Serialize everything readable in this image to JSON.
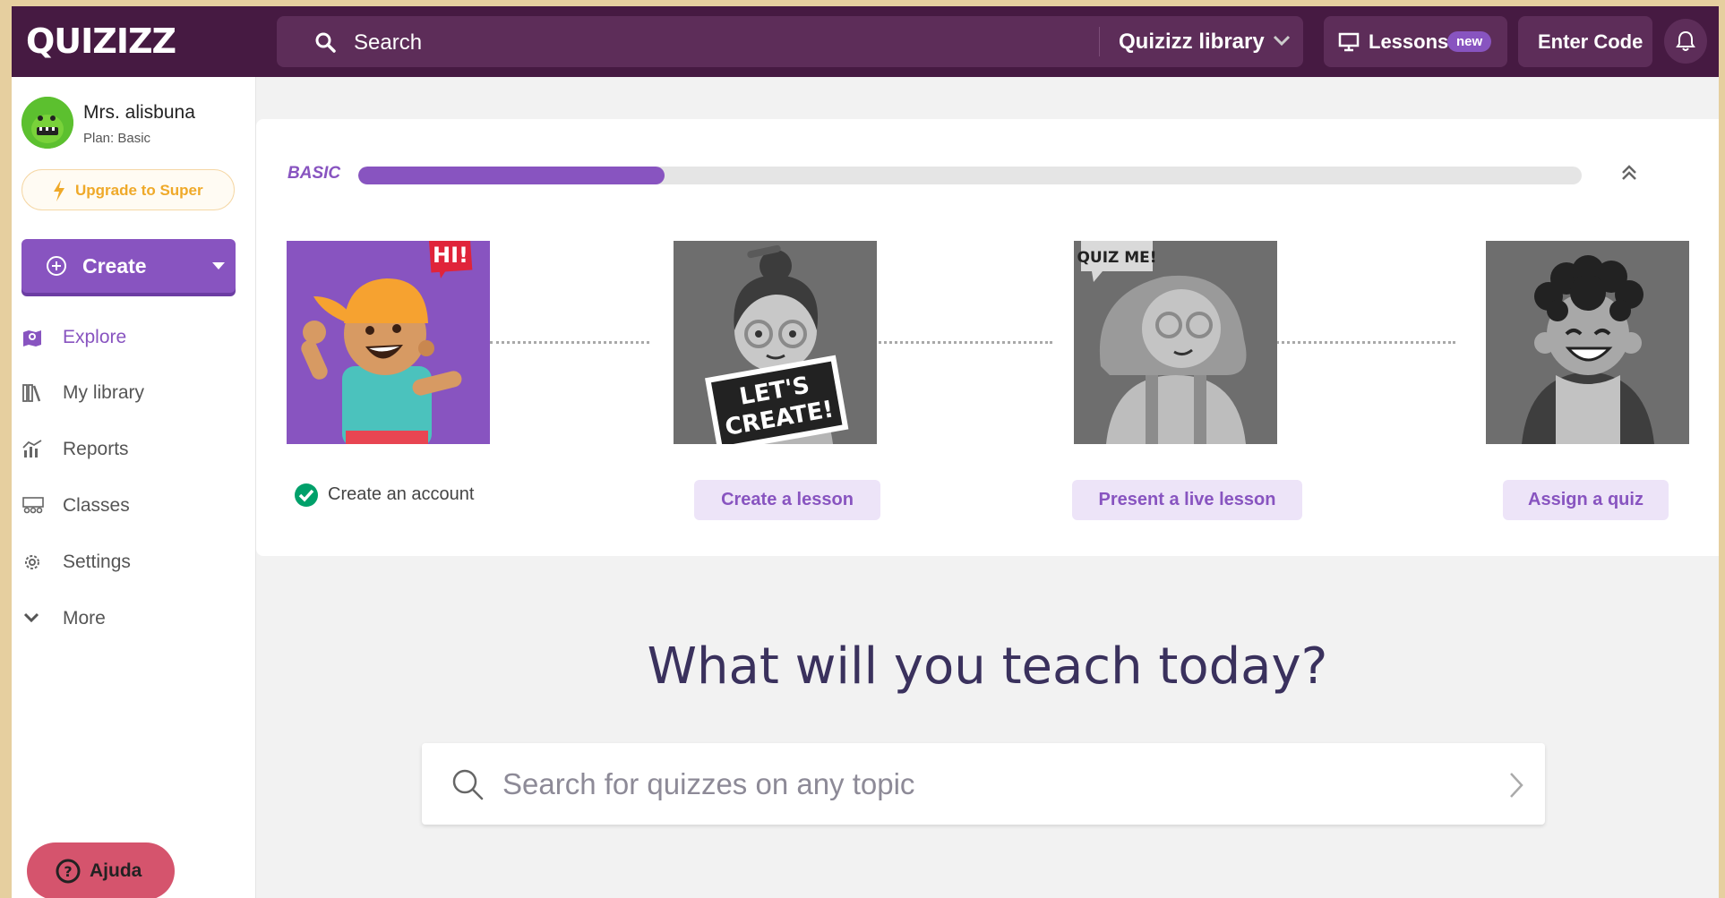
{
  "nav": {
    "logo": "QUIZIZZ",
    "search_placeholder": "Search",
    "library_select": "Quizizz library",
    "lessons_label": "Lessons",
    "lessons_badge": "new",
    "enter_code": "Enter Code"
  },
  "user": {
    "name": "Mrs. alisbuna",
    "plan": "Plan: Basic",
    "upgrade_label": "Upgrade to Super"
  },
  "sidebar": {
    "create_label": "Create",
    "items": [
      {
        "label": "Explore",
        "icon": "explore-icon",
        "active": true
      },
      {
        "label": "My library",
        "icon": "library-icon",
        "active": false
      },
      {
        "label": "Reports",
        "icon": "reports-icon",
        "active": false
      },
      {
        "label": "Classes",
        "icon": "classes-icon",
        "active": false
      },
      {
        "label": "Settings",
        "icon": "settings-icon",
        "active": false
      },
      {
        "label": "More",
        "icon": "chevron-down-icon",
        "active": false
      }
    ],
    "help_label": "Ajuda"
  },
  "onboarding": {
    "plan_label": "BASIC",
    "progress_fraction": 0.25,
    "steps": [
      {
        "label": "Create an account",
        "completed": true
      },
      {
        "label": "Create a lesson",
        "completed": false
      },
      {
        "label": "Present a live lesson",
        "completed": false
      },
      {
        "label": "Assign a quiz",
        "completed": false
      }
    ],
    "step_badges": {
      "hi": "HI!",
      "lets_create_1": "LET'S",
      "lets_create_2": "CREATE!",
      "quiz_me": "QUIZ ME!"
    }
  },
  "main": {
    "title": "What will you teach today?",
    "search_placeholder": "Search for quizzes on any topic"
  },
  "colors": {
    "nav_bg": "#461a42",
    "accent": "#8854c0",
    "upgrade": "#efa929",
    "help": "#d5546d",
    "success": "#00a06a"
  }
}
